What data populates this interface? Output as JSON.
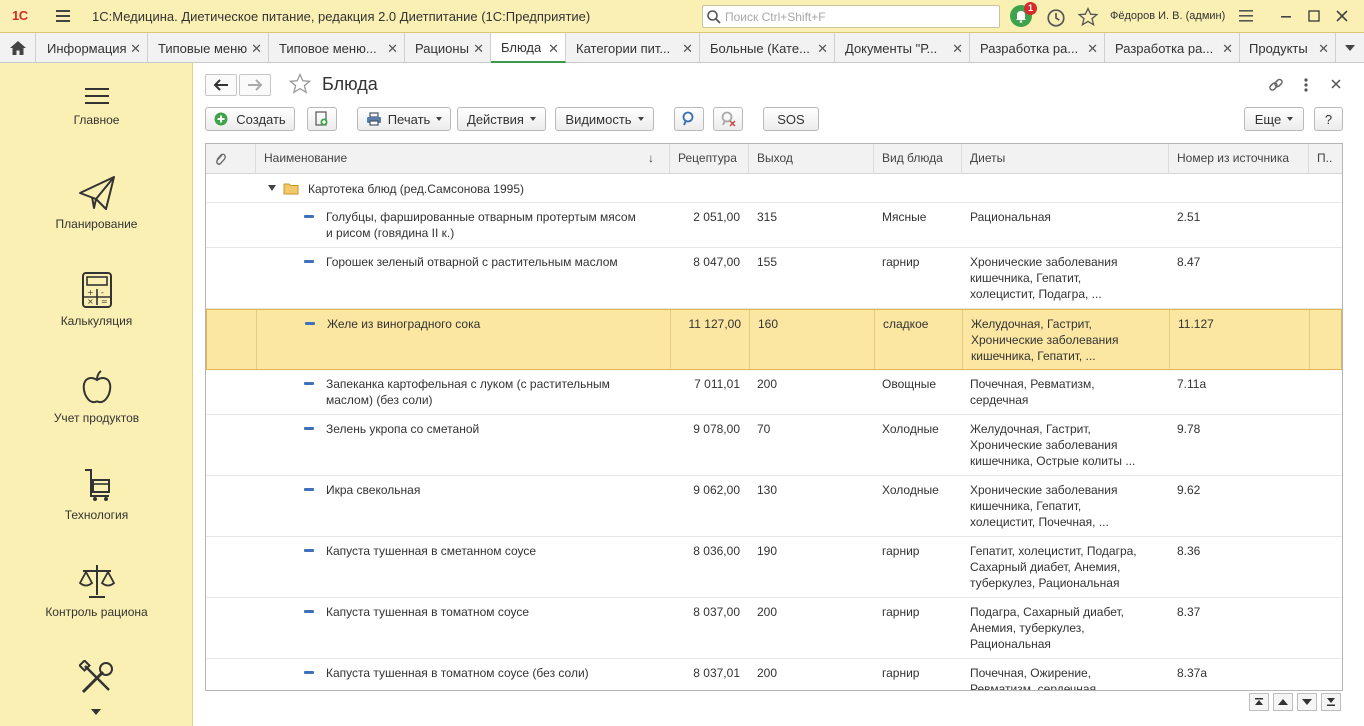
{
  "app": {
    "logo": "1С",
    "title": "1С:Медицина. Диетическое питание, редакция 2.0 Диетпитание  (1С:Предприятие)",
    "search_placeholder": "Поиск Ctrl+Shift+F",
    "notifications_count": "1",
    "user": "Фёдоров И. В. (админ)"
  },
  "tabs": [
    {
      "label": "Информация"
    },
    {
      "label": "Типовые меню"
    },
    {
      "label": "Типовое меню..."
    },
    {
      "label": "Рационы"
    },
    {
      "label": "Блюда"
    },
    {
      "label": "Категории пит..."
    },
    {
      "label": "Больные (Кате..."
    },
    {
      "label": "Документы \"Р..."
    },
    {
      "label": "Разработка ра..."
    },
    {
      "label": "Разработка ра..."
    },
    {
      "label": "Продукты"
    }
  ],
  "sidebar": {
    "items": [
      {
        "label": "Главное",
        "icon": "menu-icon"
      },
      {
        "label": "Планирование",
        "icon": "paper-plane-icon"
      },
      {
        "label": "Калькуляция",
        "icon": "calculator-icon"
      },
      {
        "label": "Учет продуктов",
        "icon": "apple-icon"
      },
      {
        "label": "Технология",
        "icon": "cart-icon"
      },
      {
        "label": "Контроль рациона",
        "icon": "scales-icon"
      },
      {
        "label": "",
        "icon": "tools-icon"
      }
    ]
  },
  "form": {
    "title": "Блюда",
    "toolbar": {
      "create": "Создать",
      "print": "Печать",
      "actions": "Действия",
      "visibility": "Видимость",
      "sos": "SOS",
      "more": "Еще",
      "help": "?"
    },
    "columns": [
      "Наименование",
      "Рецептура",
      "Выход",
      "Вид блюда",
      "Диеты",
      "Номер из источника",
      "П.."
    ],
    "group": "Картотека блюд (ред.Самсонова 1995)",
    "rows": [
      {
        "name": "Голубцы, фаршированные отварным протертым мясом\nи рисом (говядина II к.)",
        "recipe": "2 051,00",
        "yield": "315",
        "kind": "Мясные",
        "diets": "Рациональная",
        "source_no": "2.51"
      },
      {
        "name": "Горошек зеленый отварной с растительным маслом",
        "recipe": "8 047,00",
        "yield": "155",
        "kind": "гарнир",
        "diets": "Хронические заболевания\nкишечника, Гепатит,\nхолецистит, Подагра, ...",
        "source_no": "8.47"
      },
      {
        "name": "Желе из виноградного сока",
        "recipe": "11 127,00",
        "yield": "160",
        "kind": "сладкое",
        "diets": "Желудочная, Гастрит,\nХронические заболевания\nкишечника, Гепатит, ...",
        "source_no": "11.127"
      },
      {
        "name": "Запеканка картофельная с луком (с растительным\nмаслом) (без соли)",
        "recipe": "7 011,01",
        "yield": "200",
        "kind": "Овощные",
        "diets": "Почечная, Ревматизм,\nсердечная",
        "source_no": "7.11а"
      },
      {
        "name": "Зелень укропа со сметаной",
        "recipe": "9 078,00",
        "yield": "70",
        "kind": "Холодные",
        "diets": "Желудочная, Гастрит,\nХронические заболевания\nкишечника, Острые колиты ...",
        "source_no": "9.78"
      },
      {
        "name": "Икра свекольная",
        "recipe": "9 062,00",
        "yield": "130",
        "kind": "Холодные",
        "diets": "Хронические заболевания\nкишечника, Гепатит,\nхолецистит, Почечная, ...",
        "source_no": "9.62"
      },
      {
        "name": "Капуста тушенная в сметанном соусе",
        "recipe": "8 036,00",
        "yield": "190",
        "kind": "гарнир",
        "diets": "Гепатит, холецистит, Подагра,\nСахарный диабет, Анемия,\nтуберкулез, Рациональная",
        "source_no": "8.36"
      },
      {
        "name": "Капуста тушенная в томатном соусе",
        "recipe": "8 037,00",
        "yield": "200",
        "kind": "гарнир",
        "diets": "Подагра, Сахарный диабет,\nАнемия, туберкулез,\nРациональная",
        "source_no": "8.37"
      },
      {
        "name": "Капуста тушенная в томатном соусе (без соли)",
        "recipe": "8 037,01",
        "yield": "200",
        "kind": "гарнир",
        "diets": "Почечная, Ожирение,\nРевматизм, сердечная",
        "source_no": "8.37а"
      }
    ]
  }
}
